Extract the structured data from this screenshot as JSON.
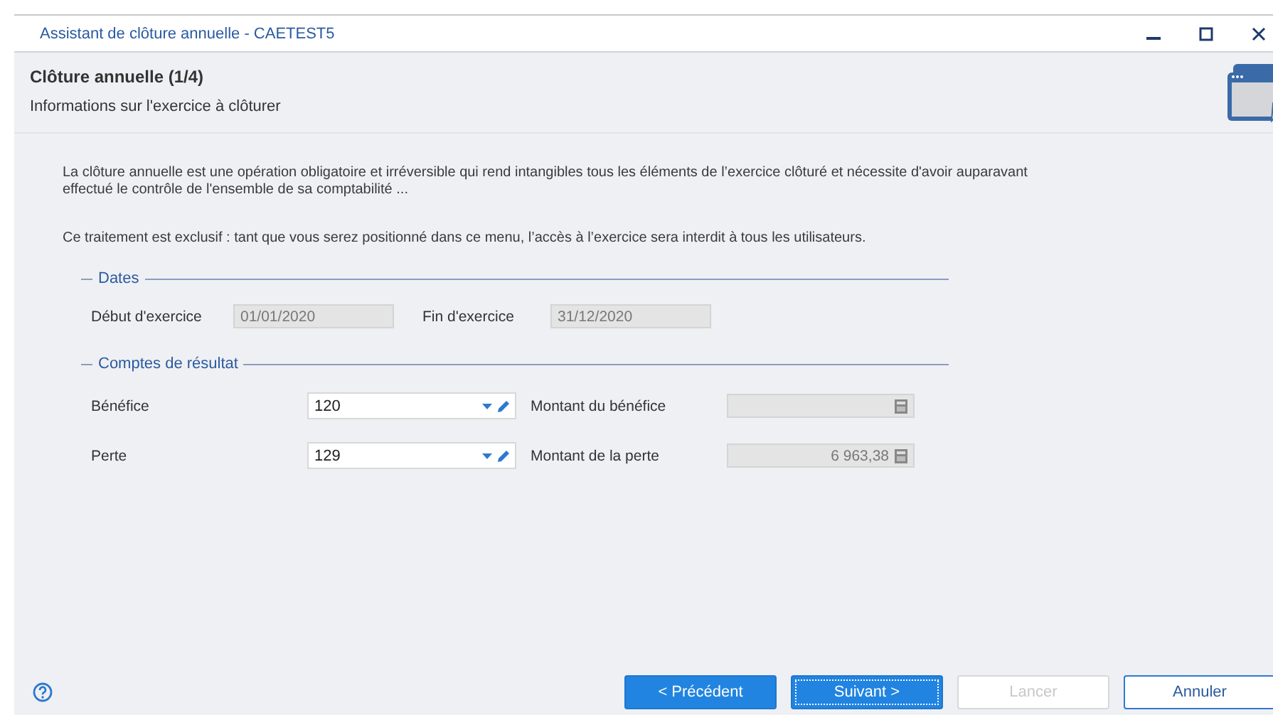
{
  "window": {
    "title": "Assistant de clôture annuelle - CAETEST5"
  },
  "header": {
    "title": "Clôture annuelle (1/4)",
    "subtitle": "Informations sur l'exercice à clôturer"
  },
  "paragraphs": [
    "La clôture annuelle est une opération obligatoire et irréversible qui rend intangibles tous les éléments de l’exercice clôturé et nécessite d'avoir auparavant effectué le contrôle de l'ensemble de sa comptabilité ...",
    "Ce traitement est exclusif : tant que vous serez positionné dans ce menu, l’accès à l’exercice sera interdit à tous les utilisateurs."
  ],
  "dates": {
    "legend": "Dates",
    "fields": [
      {
        "label": "Début d'exercice",
        "value": "01/01/2020"
      },
      {
        "label": "Fin d'exercice",
        "value": "31/12/2020"
      }
    ]
  },
  "results": {
    "legend": "Comptes de résultat",
    "rows": [
      {
        "label": "Bénéfice",
        "account": "120",
        "amount_label": "Montant du bénéfice"
      },
      {
        "label": "Perte",
        "account": "129",
        "amount_label": "Montant de la perte",
        "amount": "6 963,38"
      }
    ]
  },
  "buttons": [
    {
      "label": "< Précédent",
      "kind": "primary",
      "disabled": false,
      "focused": false
    },
    {
      "label": "Suivant >",
      "kind": "primary",
      "disabled": false,
      "focused": true
    },
    {
      "label": "Lancer",
      "kind": "secondary",
      "disabled": true,
      "focused": false
    },
    {
      "label": "Annuler",
      "kind": "secondary",
      "disabled": false,
      "focused": false
    }
  ]
}
